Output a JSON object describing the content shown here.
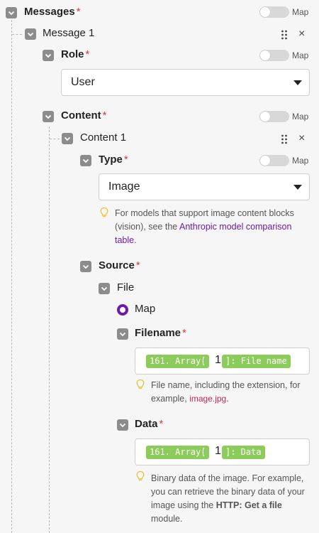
{
  "messages": {
    "label": "Messages",
    "map_label": "Map"
  },
  "message1": {
    "label": "Message 1",
    "close": "×"
  },
  "role": {
    "label": "Role",
    "map_label": "Map",
    "value": "User"
  },
  "content": {
    "label": "Content",
    "map_label": "Map"
  },
  "content1": {
    "label": "Content 1",
    "close": "×"
  },
  "type": {
    "label": "Type",
    "map_label": "Map",
    "value": "Image",
    "hint_prefix": "For models that support image content blocks (vision), see the ",
    "hint_link": "Anthropic model comparison table",
    "hint_suffix": "."
  },
  "source": {
    "label": "Source"
  },
  "file": {
    "label": "File",
    "radio_label": "Map"
  },
  "filename": {
    "label": "Filename",
    "pill1": "161. Array[",
    "index": "1",
    "pill2": "]: File name",
    "hint_prefix": "File name, including the extension, for example, ",
    "hint_code": "image.jpg",
    "hint_suffix": "."
  },
  "data": {
    "label": "Data",
    "pill1": "161. Array[",
    "index": "1",
    "pill2": "]: Data",
    "hint_prefix": "Binary data of the image. For example, you can retrieve the binary data of your image using the ",
    "hint_bold": "HTTP: Get a file",
    "hint_suffix": " module."
  },
  "required_mark": "*",
  "icons": [
    "checkbox-icon",
    "drag-handle-icon",
    "close-icon",
    "lightbulb-icon",
    "dropdown-caret-icon"
  ],
  "colors": {
    "accent": "#6b1ca9",
    "required": "#d8394a",
    "pill": "#8ccc5a",
    "checkbox": "#8c8c8c"
  }
}
